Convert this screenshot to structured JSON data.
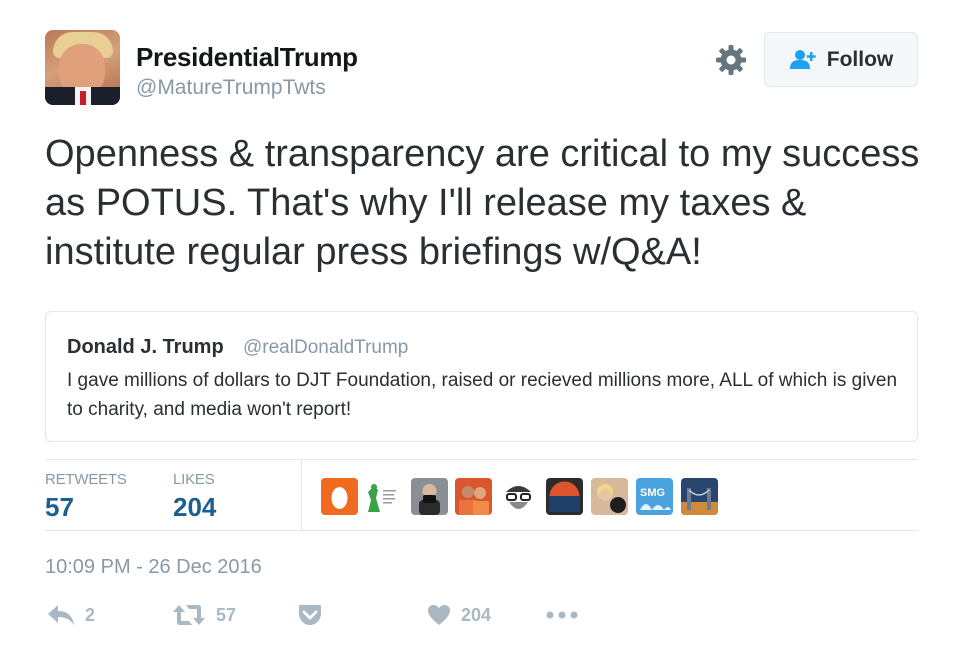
{
  "header": {
    "display_name": "PresidentialTrump",
    "username": "@MatureTrumpTwts",
    "follow_label": "Follow",
    "avatar_icon": "profile-photo",
    "settings_icon": "gear-icon"
  },
  "tweet": {
    "text": "Openness & transparency are critical to my success as POTUS. That's why I'll release my taxes & institute regular press briefings w/Q&A!"
  },
  "quoted_tweet": {
    "name": "Donald J. Trump",
    "handle": "@realDonaldTrump",
    "text": "I gave millions of dollars to DJT Foundation, raised or recieved millions more, ALL of which is given to charity, and media won't report!"
  },
  "stats": {
    "retweets_label": "RETWEETS",
    "retweets_value": "57",
    "likes_label": "LIKES",
    "likes_value": "204"
  },
  "likers": [
    {
      "name": "liker-avatar-1",
      "color": "#f06b20"
    },
    {
      "name": "liker-avatar-2",
      "color": "#ffffff"
    },
    {
      "name": "liker-avatar-3",
      "color": "#8a8f95"
    },
    {
      "name": "liker-avatar-4",
      "color": "#d9572c"
    },
    {
      "name": "liker-avatar-5",
      "color": "#ffffff"
    },
    {
      "name": "liker-avatar-6",
      "color": "#2c2c2c"
    },
    {
      "name": "liker-avatar-7",
      "color": "#d8b89a"
    },
    {
      "name": "liker-avatar-8",
      "color": "#4aa3df"
    },
    {
      "name": "liker-avatar-9",
      "color": "#27476e"
    }
  ],
  "timestamp": "10:09 PM - 26 Dec 2016",
  "actions": {
    "reply_count": "2",
    "retweet_count": "57",
    "like_count": "204"
  },
  "colors": {
    "accent_blue": "#1b5f91",
    "muted_gray": "#8899a6",
    "border": "#e1e8ed",
    "action_gray": "#aab8c2"
  }
}
